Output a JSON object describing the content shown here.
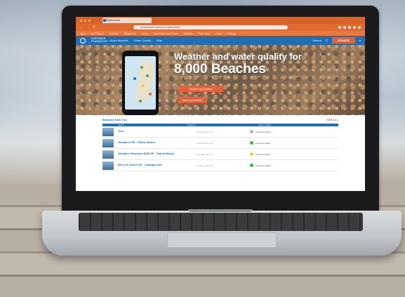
{
  "browser": {
    "tab_title": "Beachcast",
    "url": "beachcast.surfrider.org/beaches",
    "bookmarks": [
      "Apps",
      "Surf Report",
      "Surfrider",
      "Beachcast",
      "News",
      "Blue Water Task Force",
      "Weather",
      "Tide Chart",
      "Local",
      "Settings"
    ]
  },
  "site": {
    "logo_text": "SURFRIDER FOUNDATION",
    "nav_links": [
      "About Beaches",
      "Water Quality",
      "Map"
    ],
    "search_label": "Search",
    "donate_label": "DONATE",
    "hero_line1": "Weather and water quality for",
    "hero_line2": "8,000 Beaches",
    "cta_primary": "Search by location",
    "cta_secondary": "Use my location",
    "section_title": "Beaches Near You",
    "see_all": "SEE ALL",
    "table_headers": [
      "Beach",
      "Distance",
      "Water Quality"
    ],
    "beaches": [
      {
        "name": "Test",
        "sub": "Crescent City, CA",
        "status": "Unknown Status",
        "status_color": "#b8b8b8"
      },
      {
        "name": "Gleadsen SP - Public Beach",
        "sub": "Crescent City, CA",
        "status": "Unknown Status",
        "status_color": "#3bb34a"
      },
      {
        "name": "Gleadsen Beaches SHB SP - Public Beach",
        "sub": "Crescent City, CA",
        "status": "Unknown Status",
        "status_color": "#f2d23a"
      },
      {
        "name": "Berry & Dunes SP - Campground",
        "sub": "Crescent City, CA",
        "status": "Unknown Status",
        "status_color": "#3bb34a"
      }
    ]
  },
  "colors": {
    "brand_blue": "#1e6fb6",
    "accent_orange": "#e4623b",
    "browser_orange": "#e06a30"
  }
}
